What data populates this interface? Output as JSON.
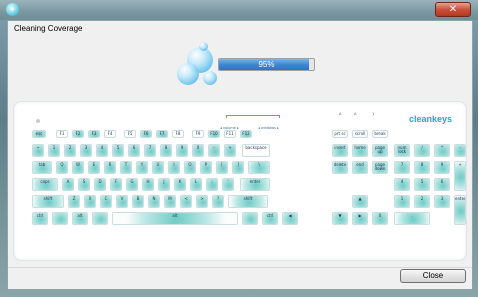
{
  "titlebar": {
    "close_glyph": "✕",
    "icon": "cleankeys-app-icon"
  },
  "window": {
    "title": "Cleaning Coverage"
  },
  "progress": {
    "label": "95%",
    "value": 0.95
  },
  "keyboard": {
    "brand": "cleankeys",
    "fn_legends": {
      "volume": "◂ volume ▸",
      "windows": "◂ windows ▸"
    },
    "indicators": [
      "A",
      "A",
      "1"
    ],
    "rows": [
      [
        "esc",
        "F1",
        "F2",
        "F3",
        "F4",
        "F5",
        "F6",
        "F7",
        "F8",
        "F9",
        "F10",
        "F11",
        "F12",
        "prt sc",
        "scroll",
        "break"
      ],
      [
        "~",
        "1",
        "2",
        "3",
        "4",
        "5",
        "6",
        "7",
        "8",
        "9",
        "0",
        "-",
        "+",
        "backspace",
        "insert",
        "home",
        "page up",
        "num lock",
        "/",
        "*",
        "-"
      ],
      [
        "tab",
        "Q",
        "W",
        "E",
        "R",
        "T",
        "Y",
        "U",
        "I",
        "O",
        "P",
        "[",
        "]",
        "\\",
        "delete",
        "end",
        "page down",
        "7",
        "8",
        "9",
        "+"
      ],
      [
        "caps",
        "A",
        "S",
        "D",
        "F",
        "G",
        "H",
        "J",
        "K",
        "L",
        ";",
        "'",
        "enter",
        "4",
        "5",
        "6"
      ],
      [
        "shift",
        "Z",
        "X",
        "C",
        "V",
        "B",
        "N",
        "M",
        "<",
        ">",
        "?",
        "shift",
        "▲",
        "1",
        "2",
        "3",
        "enter"
      ],
      [
        "ctrl",
        "",
        "alt",
        "",
        "alt",
        "",
        "ctrl",
        "◀",
        "▼",
        "▶",
        "0",
        "."
      ]
    ]
  },
  "footer": {
    "close_label": "Close"
  }
}
